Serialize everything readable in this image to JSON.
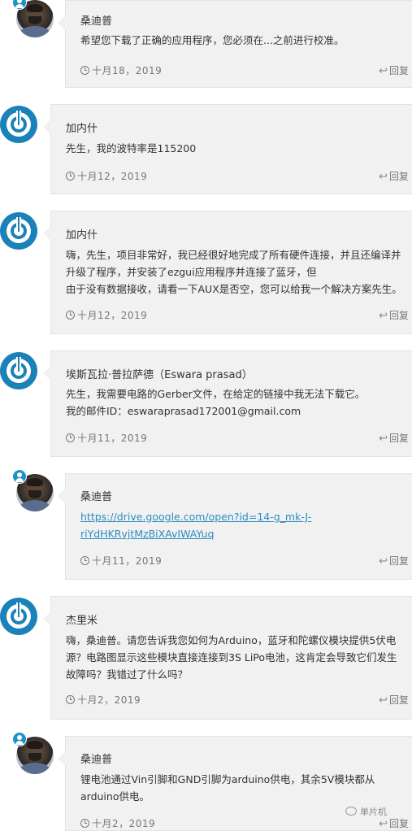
{
  "comments": [
    {
      "author": "桑迪普",
      "avatar": "photo-avatar",
      "lines": [
        "希望您下载了正确的应用程序，您必须在...之前进行校准。"
      ],
      "date": "十月18，2019",
      "reply": "回复"
    },
    {
      "author": "加内什",
      "avatar": "default-avatar",
      "lines": [
        "先生，我的波特率是115200"
      ],
      "date": "十月12，2019",
      "reply": "回复"
    },
    {
      "author": "加内什",
      "avatar": "default-avatar",
      "lines": [
        "嗨，先生，项目非常好，我已经很好地完成了所有硬件连接，并且还编译并",
        "升级了程序，并安装了ezgui应用程序并连接了蓝牙，但",
        "由于没有数据接收，请看一下AUX是否空，您可以给我一个解决方案先生。"
      ],
      "date": "十月12，2019",
      "reply": "回复"
    },
    {
      "author": "埃斯瓦拉·普拉萨德（Eswara prasad）",
      "avatar": "default-avatar",
      "lines": [
        "先生，我需要电路的Gerber文件，在给定的链接中我无法下载它。",
        "我的邮件ID：eswaraprasad172001@gmail.com"
      ],
      "date": "十月11，2019",
      "reply": "回复"
    },
    {
      "author": "桑迪普",
      "avatar": "photo-avatar",
      "link_lines": [
        "https://drive.google.com/open?id=14-g_mk-J-",
        "riYdHKRvjtMzBiXAvIWAYuq"
      ],
      "date": "十月11，2019",
      "reply": "回复"
    },
    {
      "author": "杰里米",
      "avatar": "default-avatar",
      "lines": [
        "嗨，桑迪普。请您告诉我您如何为Arduino，蓝牙和陀螺仪模块提供5伏电",
        "源？电路图显示这些模块直接连接到3S LiPo电池，这肯定会导致它们发生",
        "故障吗？我错过了什么吗？"
      ],
      "date": "十月2，2019",
      "reply": "回复"
    },
    {
      "author": "桑迪普",
      "avatar": "photo-avatar",
      "lines": [
        "锂电池通过Vin引脚和GND引脚为arduino供电，其余5V模块都从",
        "arduino供电。"
      ],
      "date": "十月2，2019",
      "reply": "回复"
    }
  ],
  "watermark": "单片机"
}
